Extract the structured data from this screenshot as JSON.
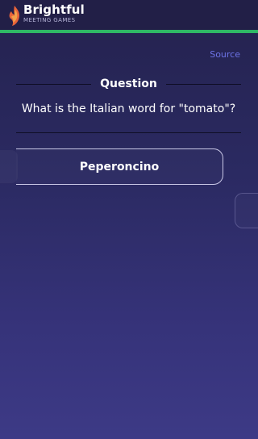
{
  "brand": {
    "name": "Brightful",
    "tagline": "MEETING GAMES",
    "icon": "flame-logo-icon"
  },
  "progress": {
    "fraction": 1.0
  },
  "source_link": "Source",
  "question": {
    "heading": "Question",
    "text": "What is the Italian word for \"tomato\"?"
  },
  "answer": {
    "label": "Peperoncino"
  },
  "colors": {
    "header_bg": "#221f47",
    "progress": "#2fb865",
    "link": "#6d73e6",
    "background_top": "#24224e",
    "background_bottom": "#3d3a86"
  }
}
